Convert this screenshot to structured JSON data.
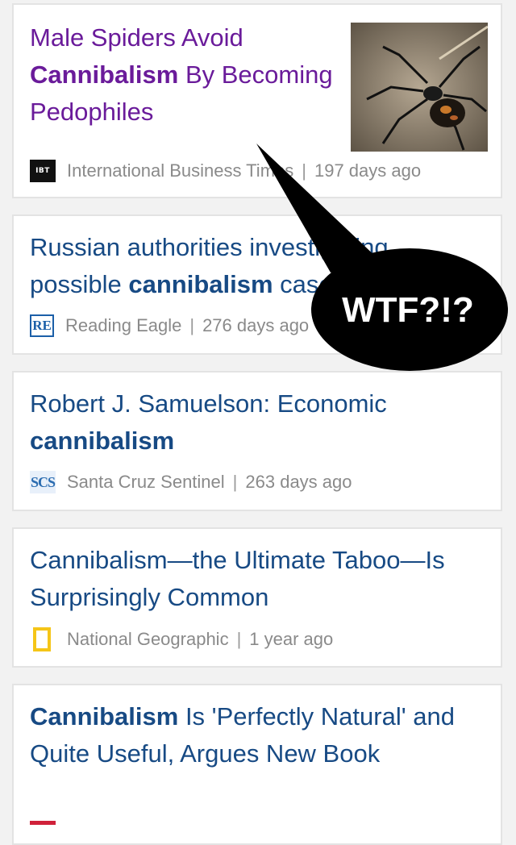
{
  "articles": [
    {
      "title_pre": "Male Spiders Avoid ",
      "title_bold": "Cannibalism",
      "title_post": " By Becoming Pedophiles",
      "source": "International Business Times",
      "logo_text": "IBT",
      "age": "197 days ago"
    },
    {
      "title_pre": "Russian authorities investigating possible ",
      "title_bold": "cannibalism",
      "title_post": " case",
      "source": "Reading Eagle",
      "logo_text": "RE",
      "age": "276 days ago"
    },
    {
      "title_pre": "Robert J. Samuelson: Economic ",
      "title_bold": "cannibalism",
      "title_post": "",
      "source": "Santa Cruz Sentinel",
      "logo_text": "SCS",
      "age": "263 days ago"
    },
    {
      "title_pre": "Cannibalism—the Ultimate Taboo—Is Surprisingly Common",
      "title_bold": "",
      "title_post": "",
      "source": "National Geographic",
      "logo_text": "",
      "age": "1 year ago"
    },
    {
      "title_pre": "",
      "title_bold": "Cannibalism",
      "title_post": " Is 'Perfectly Natural' and Quite Useful, Argues New Book",
      "source": "",
      "logo_text": "",
      "age": ""
    }
  ],
  "separator": "|",
  "callout": {
    "text": "WTF?!?"
  },
  "colors": {
    "link": "#174a84",
    "visited": "#6a1b9a",
    "meta": "#8a8a8a",
    "ng_yellow": "#f5c518"
  }
}
